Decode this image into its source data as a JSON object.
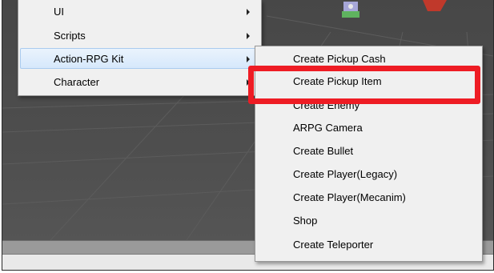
{
  "main_menu": {
    "items": [
      {
        "label": "UI",
        "has_submenu": true
      },
      {
        "label": "Scripts",
        "has_submenu": true
      },
      {
        "label": "Action-RPG Kit",
        "has_submenu": true,
        "active": true
      },
      {
        "label": "Character",
        "has_submenu": true
      }
    ]
  },
  "submenu": {
    "parent": "Action-RPG Kit",
    "items": [
      {
        "label": "Create Pickup Cash"
      },
      {
        "label": "Create Pickup Item",
        "highlighted": true
      },
      {
        "label": "Create Enemy"
      },
      {
        "label": "ARPG Camera"
      },
      {
        "label": "Create Bullet"
      },
      {
        "label": "Create Player(Legacy)"
      },
      {
        "label": "Create Player(Mecanim)"
      },
      {
        "label": "Shop"
      },
      {
        "label": "Create Teleporter"
      }
    ]
  },
  "colors": {
    "highlight_border": "#ee1c24",
    "menu_background": "#f0f0f0",
    "hover_background": "#d6e8fb"
  },
  "icons": {
    "submenu_arrow": "chevron-right-icon"
  }
}
